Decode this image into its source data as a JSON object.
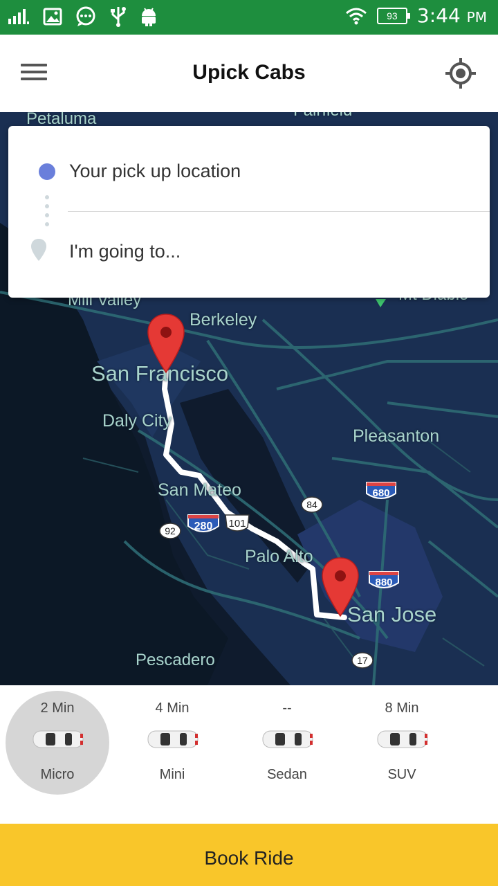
{
  "status_bar": {
    "battery": "93",
    "time": "3:44",
    "ampm": "PM"
  },
  "app_bar": {
    "title": "Upick Cabs"
  },
  "location_card": {
    "pickup_placeholder": "Your pick up location",
    "destination_placeholder": "I'm going to..."
  },
  "map": {
    "labels": {
      "petaluma": "Petaluma",
      "fairfield": "Fairfield",
      "mill_valley": "Mill Valley",
      "mt_diablo": "Mt Diablo",
      "berkeley": "Berkeley",
      "san_francisco": "San Francisco",
      "daly_city": "Daly City",
      "pleasanton": "Pleasanton",
      "san_mateo": "San Mateo",
      "palo_alto": "Palo Alto",
      "san_jose": "San Jose",
      "pescadero": "Pescadero"
    },
    "shields": {
      "i680": "680",
      "ca84": "84",
      "us101": "101",
      "i280": "280",
      "ca92": "92",
      "i880": "880",
      "ca17": "17"
    },
    "colors": {
      "water": "#0f1b2d",
      "land": "#1a2f52",
      "road": "#2e6b74",
      "route": "#ffffff",
      "marker": "#e53935"
    }
  },
  "rides": [
    {
      "eta": "2 Min",
      "name": "Micro",
      "selected": true
    },
    {
      "eta": "4 Min",
      "name": "Mini",
      "selected": false
    },
    {
      "eta": "--",
      "name": "Sedan",
      "selected": false
    },
    {
      "eta": "8 Min",
      "name": "SUV",
      "selected": false
    }
  ],
  "book_button": {
    "label": "Book Ride"
  }
}
